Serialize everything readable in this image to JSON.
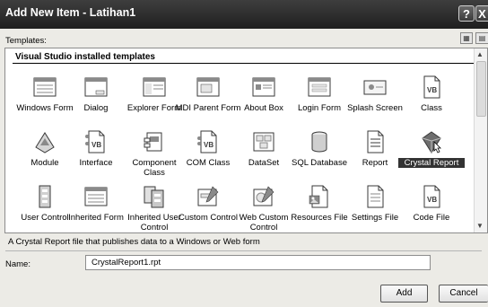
{
  "window": {
    "title": "Add New Item - Latihan1",
    "help_label": "?",
    "close_label": "X"
  },
  "templates_label": "Templates:",
  "view_buttons": {
    "large_icons": "large-icons-icon",
    "small_icons": "small-icons-icon"
  },
  "group_title": "Visual Studio installed templates",
  "items": [
    {
      "label": "Windows Form",
      "icon": "windows-form-icon"
    },
    {
      "label": "Dialog",
      "icon": "dialog-icon"
    },
    {
      "label": "Explorer Form",
      "icon": "explorer-form-icon"
    },
    {
      "label": "MDI Parent Form",
      "icon": "mdi-parent-form-icon"
    },
    {
      "label": "About Box",
      "icon": "about-box-icon"
    },
    {
      "label": "Login Form",
      "icon": "login-form-icon"
    },
    {
      "label": "Splash Screen",
      "icon": "splash-screen-icon"
    },
    {
      "label": "Class",
      "icon": "class-vb-icon"
    },
    {
      "label": "Module",
      "icon": "module-icon"
    },
    {
      "label": "Interface",
      "icon": "interface-icon"
    },
    {
      "label": "Component Class",
      "icon": "component-class-icon"
    },
    {
      "label": "COM Class",
      "icon": "com-class-icon"
    },
    {
      "label": "DataSet",
      "icon": "dataset-icon"
    },
    {
      "label": "SQL Database",
      "icon": "sql-database-icon"
    },
    {
      "label": "Report",
      "icon": "report-icon"
    },
    {
      "label": "Crystal Report",
      "icon": "crystal-report-icon",
      "selected": true
    },
    {
      "label": "User Control",
      "icon": "user-control-icon"
    },
    {
      "label": "Inherited Form",
      "icon": "inherited-form-icon"
    },
    {
      "label": "Inherited User Control",
      "icon": "inherited-user-control-icon"
    },
    {
      "label": "Custom Control",
      "icon": "custom-control-icon"
    },
    {
      "label": "Web Custom Control",
      "icon": "web-custom-control-icon"
    },
    {
      "label": "Resources File",
      "icon": "resources-file-icon"
    },
    {
      "label": "Settings File",
      "icon": "settings-file-icon"
    },
    {
      "label": "Code File",
      "icon": "code-file-icon"
    }
  ],
  "description": "A Crystal Report file that publishes data to a Windows or Web form",
  "name_label": "Name:",
  "name_value": "CrystalReport1.rpt",
  "buttons": {
    "add": "Add",
    "cancel": "Cancel"
  }
}
